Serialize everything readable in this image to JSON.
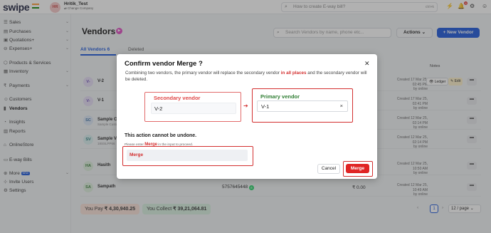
{
  "app": {
    "logo": "swipe",
    "user_initials": "HR",
    "company_name": "Hritik_Test",
    "change_company": "Change Company",
    "search_placeholder": "How to create E-way bill?",
    "search_shortcut": "ctrl+k",
    "notification_count": "6",
    "colors": {
      "accent": "#1a56db",
      "danger": "#e02424"
    }
  },
  "sidebar": {
    "items": [
      {
        "label": "Sales",
        "icon": "sales-icon"
      },
      {
        "label": "Purchases",
        "icon": "purchases-icon"
      },
      {
        "label": "Quotations+",
        "icon": "quotations-icon"
      },
      {
        "label": "Expenses+",
        "icon": "expenses-icon"
      },
      {
        "label": "Products & Services",
        "icon": "products-icon"
      },
      {
        "label": "Inventory",
        "icon": "inventory-icon"
      },
      {
        "label": "Payments",
        "icon": "payments-icon"
      },
      {
        "label": "Customers",
        "icon": "customers-icon"
      },
      {
        "label": "Vendors",
        "icon": "vendors-icon"
      },
      {
        "label": "Insights",
        "icon": "insights-icon"
      },
      {
        "label": "Reports",
        "icon": "reports-icon"
      },
      {
        "label": "OnlineStore",
        "icon": "store-icon"
      },
      {
        "label": "E-way Bills",
        "icon": "truck-icon"
      },
      {
        "label": "More",
        "icon": "more-icon"
      },
      {
        "label": "Invite Users",
        "icon": "invite-icon"
      },
      {
        "label": "Settings",
        "icon": "settings-icon"
      }
    ],
    "new_badge": "NEW"
  },
  "page": {
    "title": "Vendors",
    "search_placeholder": "Search Vendors by name, phone etc...",
    "actions_label": "Actions",
    "new_vendor_label": "+ New Vendor",
    "tabs": [
      "All Vendors",
      "Deleted"
    ],
    "all_vendors_count": "6",
    "notes_header": "Notes"
  },
  "rows": [
    {
      "initials": "V-",
      "name": "V-2",
      "sub": "",
      "created": "Created 17 Mar 25, 02:45 PM",
      "by": "by online"
    },
    {
      "initials": "V-",
      "name": "V-1",
      "sub": "",
      "created": "Created 17 Mar 25, 02:41 PM",
      "by": "by online"
    },
    {
      "initials": "SC",
      "name": "Sample C",
      "sub": "Sample Custo",
      "created": "Created 12 Mar 25, 02:14 PM",
      "by": "by online"
    },
    {
      "initials": "SV",
      "name": "Sample Ve",
      "sub": "18SSLPP66",
      "created": "Created 12 Mar 25, 02:14 PM",
      "by": "by online"
    },
    {
      "initials": "HA",
      "name": "Hasith",
      "sub": "",
      "created": "Created 12 Mar 25, 10:50 AM",
      "by": "by online"
    },
    {
      "initials": "SA",
      "name": "Sampath",
      "sub": "",
      "phone": "5757645448",
      "balance": "₹ 0.00",
      "created": "Created 12 Mar 25, 10:49 AM",
      "by": "by online"
    }
  ],
  "row_actions": {
    "ledger": "Ledger",
    "edit": "Edit",
    "more": "•••"
  },
  "footer": {
    "you_pay_label": "You Pay",
    "you_pay_amount": "₹ 4,30,940.25",
    "you_collect_label": "You Collect",
    "you_collect_amount": "₹ 39,21,064.81",
    "current_page": "1",
    "per_page": "12 / page"
  },
  "modal": {
    "title": "Confirm vendor Merge ?",
    "desc_part1": "Combining two vendors, the primary vendor will replace the secondary vendor ",
    "desc_highlight": "in all places",
    "desc_part2": " and the secondary vendor will be deleted.",
    "secondary_label": "Secondary vendor",
    "secondary_value": "V-2",
    "primary_label": "Primary vendor",
    "primary_value": "V-1",
    "undone_text": "This action cannot be undone.",
    "hint_before": "Please enter ",
    "hint_keyword": "Merge",
    "hint_after": " in the input to proceed.",
    "merge_input_value": "Merge",
    "cancel_label": "Cancel",
    "merge_label": "Merge"
  }
}
